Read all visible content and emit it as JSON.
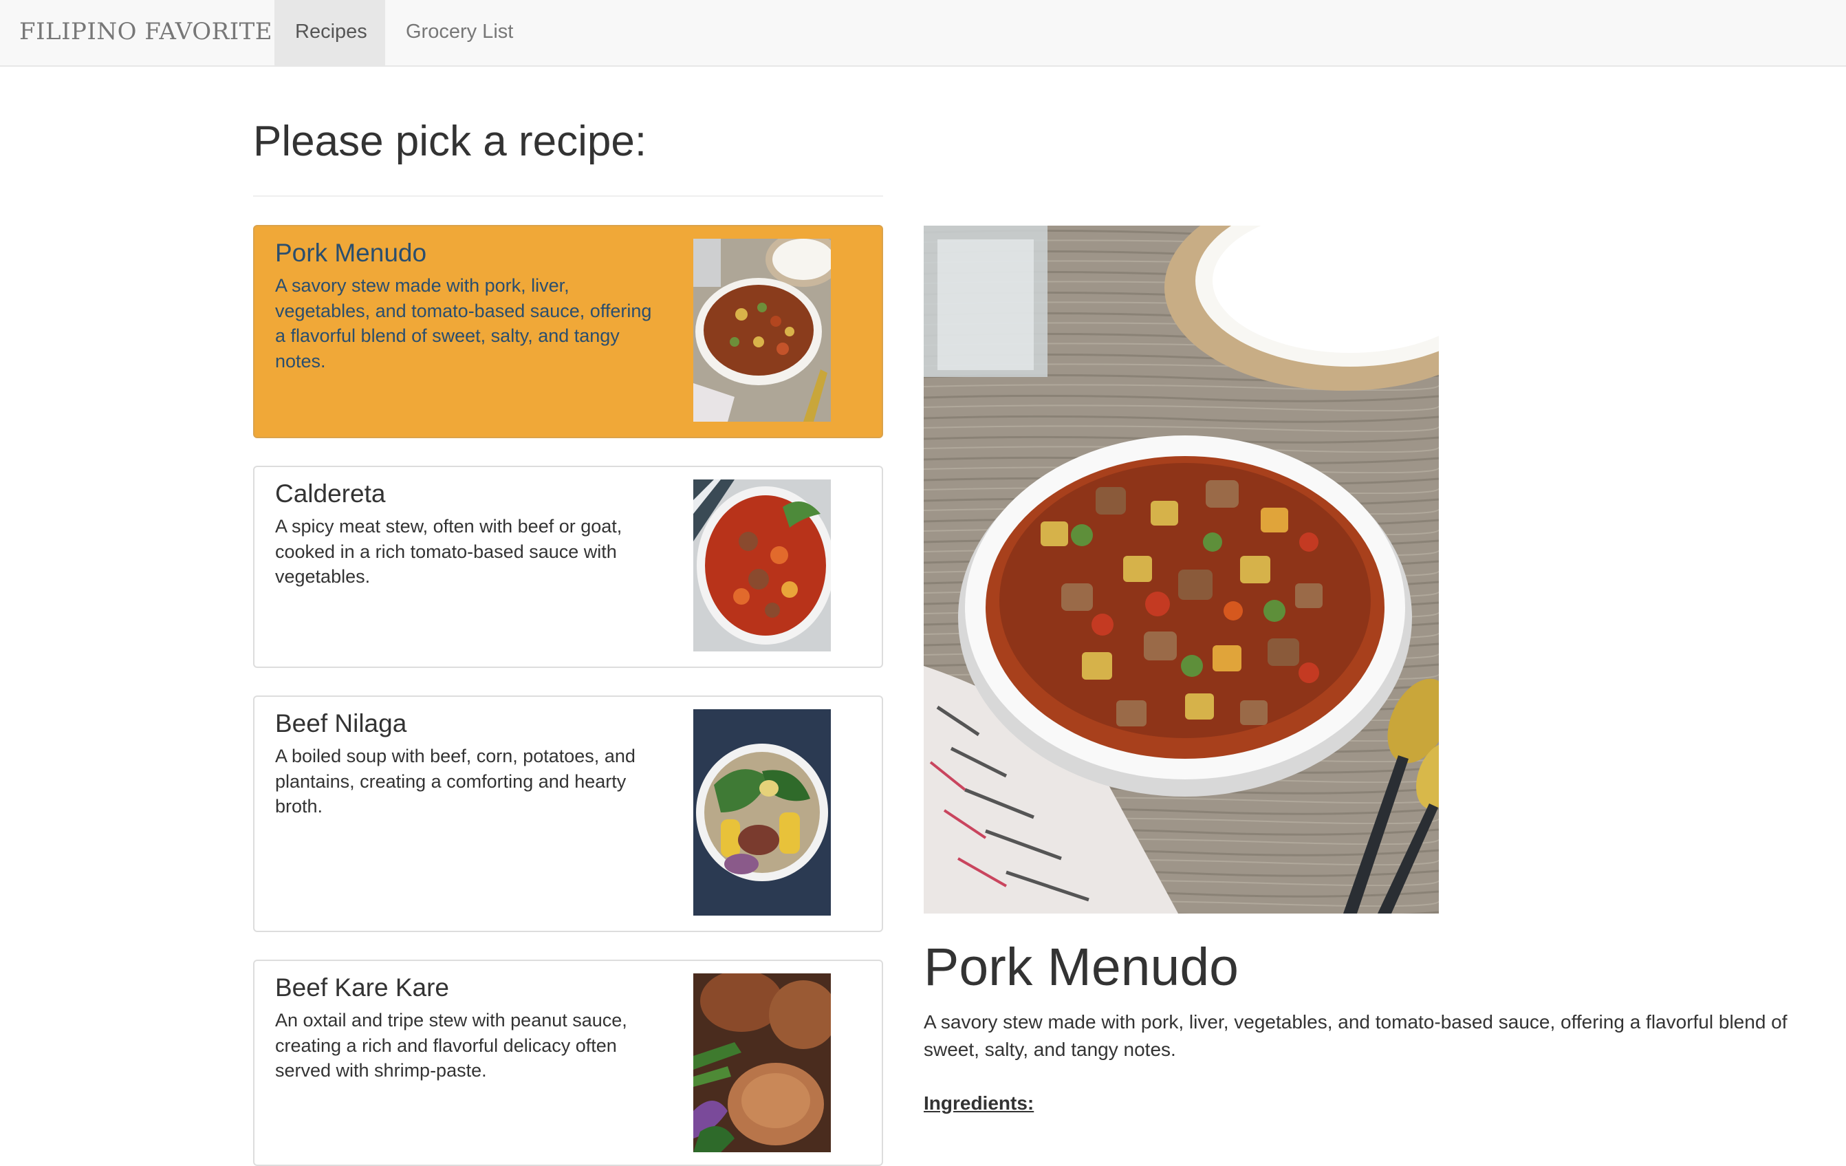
{
  "navbar": {
    "brand": "FILIPINO FAVORITES",
    "tabs": [
      {
        "label": "Recipes",
        "active": true
      },
      {
        "label": "Grocery List",
        "active": false
      }
    ]
  },
  "main": {
    "heading": "Please pick a recipe:",
    "recipes": [
      {
        "name": "Pork Menudo",
        "description": "A savory stew made with pork, liver, vegetables, and tomato-based sauce, offering a flavorful blend of sweet, salty, and tangy notes.",
        "selected": true
      },
      {
        "name": "Caldereta",
        "description": "A spicy meat stew, often with beef or goat, cooked in a rich tomato-based sauce with vegetables.",
        "selected": false
      },
      {
        "name": "Beef Nilaga",
        "description": "A boiled soup with beef, corn, potatoes, and plantains, creating a comforting and hearty broth.",
        "selected": false
      },
      {
        "name": "Beef Kare Kare",
        "description": "An oxtail and tripe stew with peanut sauce, creating a rich and flavorful delicacy often served with shrimp-paste.",
        "selected": false
      }
    ]
  },
  "detail": {
    "name": "Pork Menudo",
    "description": "A savory stew made with pork, liver, vegetables, and tomato-based sauce, offering a flavorful blend of sweet, salty, and tangy notes.",
    "ingredients_label": "Ingredients:"
  },
  "colors": {
    "selected_card": "#f0a838",
    "navbar_bg": "#f8f8f8",
    "active_tab_bg": "#e7e7e7"
  }
}
